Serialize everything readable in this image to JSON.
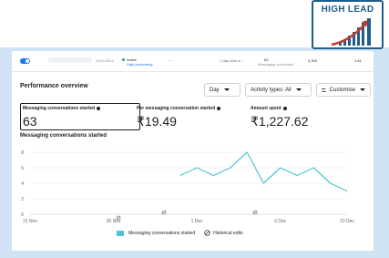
{
  "ad_row": {
    "date": "29/11/2024",
    "status": "Active",
    "status_sub": "High performing",
    "dash": "—",
    "window": "7-day click or ...",
    "result": "63",
    "result_sub": "Messaging conversati",
    "reach": "2,300",
    "cost": "1.61"
  },
  "performance": {
    "title": "Performance overview",
    "day_dropdown": "Day",
    "activity_dropdown": "Activity types: All",
    "customise_button": "Customise"
  },
  "metrics": [
    {
      "label": "Messaging conversations started",
      "value": "63"
    },
    {
      "label": "Per messaging conversation started",
      "value": "₹19.49"
    },
    {
      "label": "Amount spent",
      "value": "₹1,227.62"
    }
  ],
  "chart_data": {
    "type": "line",
    "title": "Messaging conversations started",
    "x": [
      "30 Nov",
      "1 Dec",
      "2 Dec",
      "3 Dec",
      "4 Dec",
      "5 Dec",
      "6 Dec",
      "7 Dec",
      "8 Dec",
      "9 Dec",
      "10 Dec"
    ],
    "series": [
      {
        "name": "Messaging conversations started",
        "values": [
          5,
          6,
          5,
          6,
          8,
          4,
          6,
          5,
          6,
          4,
          3
        ]
      }
    ],
    "x_ticks": [
      "21 Nov",
      "26 Nov",
      "1 Dec",
      "6 Dec",
      "10 Dec"
    ],
    "y_ticks": [
      "0",
      "2",
      "4",
      "6",
      "8"
    ],
    "ylim": [
      0,
      8
    ],
    "grid": true,
    "line_color": "#4fc3cf",
    "legend": [
      "Messaging conversations started",
      "Historical edits"
    ],
    "legend_position": "bottom"
  },
  "logo": {
    "text": "HIGH LEAD"
  },
  "colors": {
    "accent": "#1877f2",
    "line": "#4fc3cf",
    "logo": "#1f5d8a",
    "logo_arrow": "#c0392b"
  }
}
